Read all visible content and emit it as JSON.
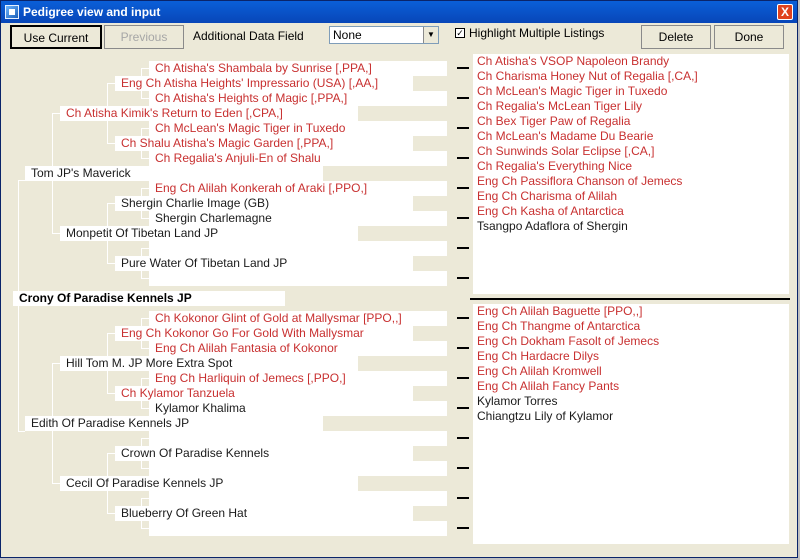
{
  "window": {
    "title": "Pedigree view and input",
    "close_label": "X"
  },
  "toolbar": {
    "use_current": "Use Current",
    "previous": "Previous",
    "additional_label": "Additional Data Field",
    "field_value": "None",
    "highlight_label": "Highlight Multiple Listings",
    "highlight_checked": "✓",
    "delete": "Delete",
    "done": "Done"
  },
  "subject": "Crony Of Paradise Kennels JP",
  "sire": {
    "name": "Tom JP's Maverick",
    "sire": {
      "name": "Ch Atisha Kimik's Return to Eden [,CPA,]",
      "sire": {
        "name": "Eng Ch Atisha Heights' Impressario (USA) [,AA,]",
        "sire": "Ch Atisha's Shambala by Sunrise [,PPA,]",
        "dam": "Ch Atisha's Heights of Magic [,PPA,]"
      },
      "dam": {
        "name": "Ch Shalu Atisha's Magic Garden [,PPA,]",
        "sire": "Ch McLean's Magic Tiger in Tuxedo",
        "dam": "Ch Regalia's Anjuli-En of Shalu"
      }
    },
    "dam": {
      "name": "Monpetit Of Tibetan Land JP",
      "sire": {
        "name": "Shergin Charlie Image (GB)",
        "sire": "Eng Ch Alilah Konkerah of Araki [,PPO,]",
        "dam": "Shergin Charlemagne"
      },
      "dam": {
        "name": "Pure Water Of Tibetan Land JP",
        "sire": "",
        "dam": ""
      }
    }
  },
  "dam": {
    "name": "Edith Of Paradise Kennels JP",
    "sire": {
      "name": "Hill Tom M. JP More Extra Spot",
      "sire": {
        "name": "Eng Ch Kokonor Go For Gold With Mallysmar",
        "sire": "Ch Kokonor Glint of Gold at Mallysmar [PPO,,]",
        "dam": "Eng Ch Alilah Fantasia of Kokonor"
      },
      "dam": {
        "name": "Ch Kylamor Tanzuela",
        "sire": "Eng Ch Harliquin of Jemecs [,PPO,]",
        "dam": "Kylamor Khalima"
      }
    },
    "dam": {
      "name": "Cecil Of Paradise Kennels JP",
      "sire": {
        "name": "Crown Of Paradise Kennels",
        "sire": "",
        "dam": ""
      },
      "dam": {
        "name": "Blueberry Of Green Hat",
        "sire": "",
        "dam": ""
      }
    }
  },
  "gen5_top": [
    "Ch Atisha's VSOP Napoleon Brandy",
    "Ch Charisma Honey Nut of Regalia [,CA,]",
    "Ch McLean's Magic Tiger in Tuxedo",
    "Ch Regalia's McLean Tiger Lily",
    "Ch Bex Tiger Paw of Regalia",
    "Ch McLean's Madame Du Bearie",
    "Ch Sunwinds Solar Eclipse [,CA,]",
    "Ch Regalia's Everything Nice",
    "Eng Ch Passiflora Chanson of Jemecs",
    "Eng Ch Charisma of Alilah",
    "Eng Ch Kasha of Antarctica",
    "Tsangpo Adaflora of Shergin",
    "",
    "",
    "",
    ""
  ],
  "gen5_bottom": [
    "Eng Ch Alilah Baguette [PPO,,]",
    "Eng Ch Thangme of Antarctica",
    "Eng Ch Dokham Fasolt of Jemecs",
    "Eng Ch Hardacre Dilys",
    "Eng Ch Alilah Kromwell",
    "Eng Ch Alilah Fancy Pants",
    "Kylamor Torres",
    "Chiangtzu Lily of Kylamor",
    "",
    "",
    "",
    "",
    "",
    "",
    "",
    ""
  ],
  "colors": {
    "highlight": "#c83030",
    "normal": "#1a1a1a",
    "band": "#ffffff",
    "background": "#ece9d8"
  }
}
